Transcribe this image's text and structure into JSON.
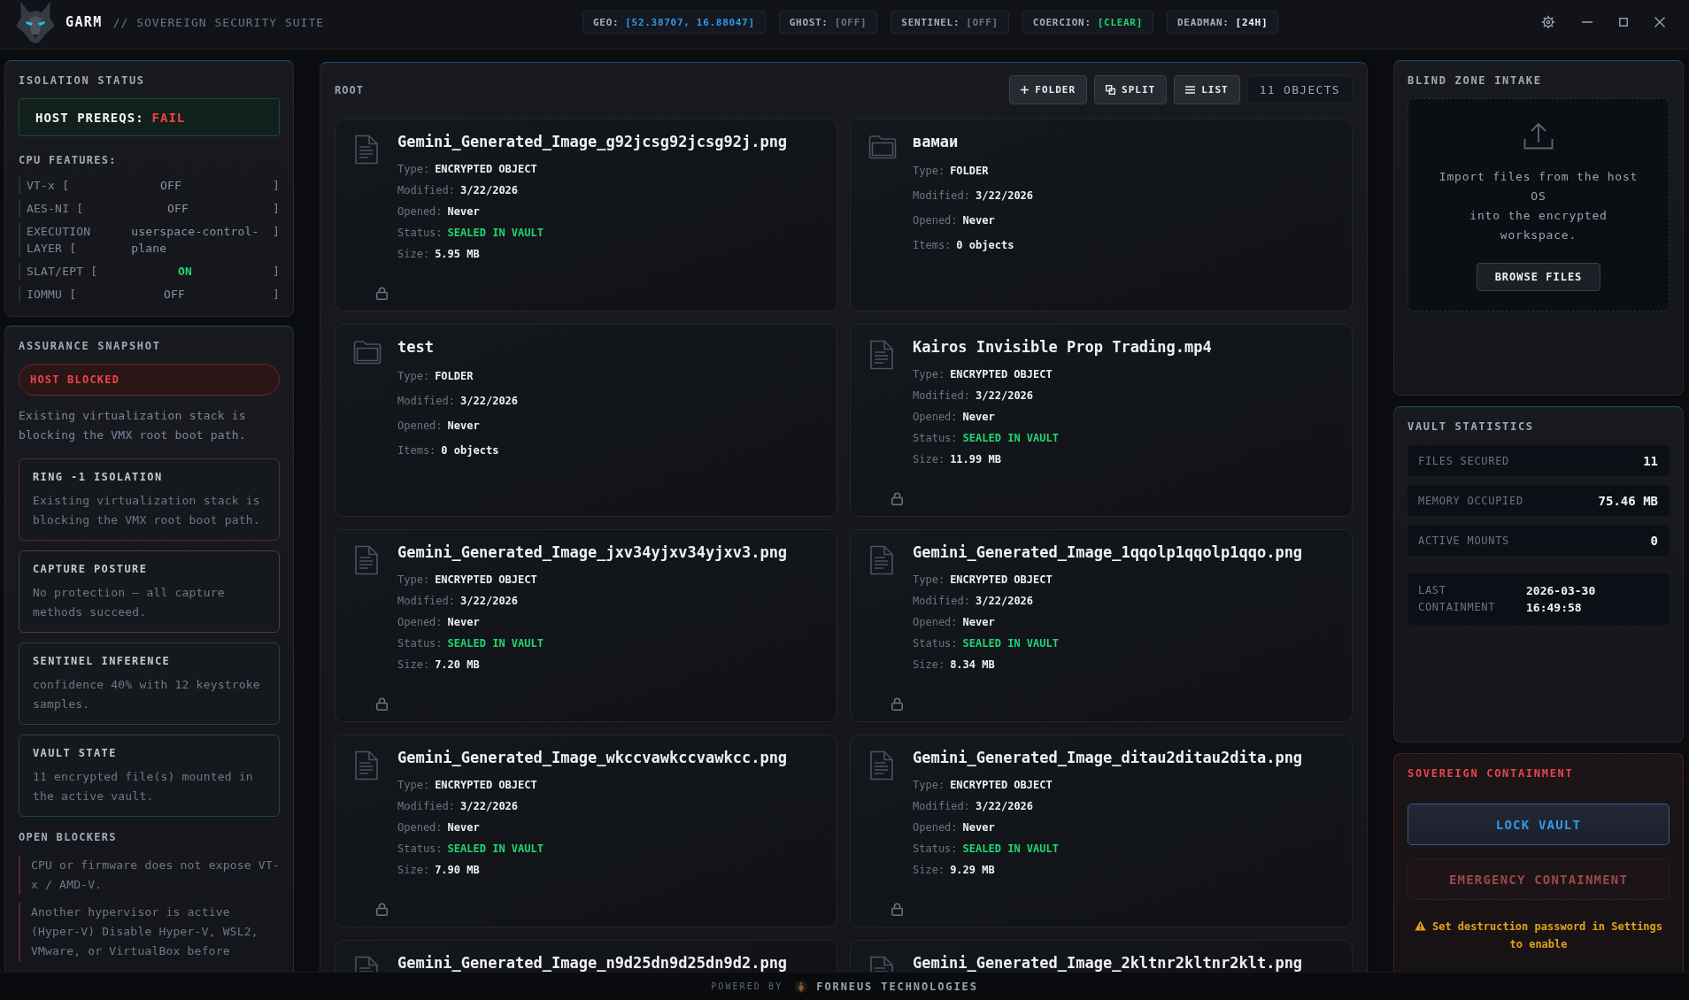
{
  "app": {
    "name": "GARM",
    "subtitle": "// SOVEREIGN SECURITY SUITE"
  },
  "status_chips": [
    {
      "label": "GEO:",
      "value": "[52.38707, 16.88047]",
      "color": "#2f9be8"
    },
    {
      "label": "GHOST:",
      "value": "[OFF]",
      "color": "#6b7385"
    },
    {
      "label": "SENTINEL:",
      "value": "[OFF]",
      "color": "#6b7385"
    },
    {
      "label": "COERCION:",
      "value": "[CLEAR]",
      "color": "#1ed772"
    },
    {
      "label": "DEADMAN:",
      "value": "[24H]",
      "color": "#f2f4f7"
    }
  ],
  "isolation_status": {
    "title": "ISOLATION STATUS",
    "host_prereqs": {
      "label": "HOST PREREQS:",
      "value": "FAIL",
      "passed": false
    },
    "cpu_features_title": "CPU FEATURES:",
    "cpu_features": [
      {
        "label": "VT-x [",
        "value": "OFF",
        "bracket": "]",
        "on": false
      },
      {
        "label": "AES-NI [",
        "value": "OFF",
        "bracket": "]",
        "on": false
      },
      {
        "label": "EXECUTION LAYER [",
        "value": "userspace-control-plane",
        "bracket": "]",
        "on": false
      },
      {
        "label": "SLAT/EPT [",
        "value": "ON",
        "bracket": "]",
        "on": true
      },
      {
        "label": "IOMMU [",
        "value": "OFF",
        "bracket": "]",
        "on": false
      }
    ]
  },
  "assurance": {
    "title": "ASSURANCE SNAPSHOT",
    "status": {
      "label": "HOST BLOCKED",
      "blocked": true
    },
    "summary": "Existing virtualization stack is blocking the VMX root boot path.",
    "cards": [
      {
        "title": "RING -1 ISOLATION",
        "text": "Existing virtualization stack is blocking the VMX root boot path.",
        "color": "#5a2b30"
      },
      {
        "title": "CAPTURE POSTURE",
        "text": "No protection – all capture methods succeed.",
        "color": "#4d4128"
      },
      {
        "title": "SENTINEL INFERENCE",
        "text": "confidence 40% with 12 keystroke samples.",
        "color": "#1f4a3a"
      },
      {
        "title": "VAULT STATE",
        "text": "11 encrypted file(s) mounted in the active vault.",
        "color": "#1f4a3a"
      }
    ],
    "blockers_title": "OPEN BLOCKERS",
    "blockers": [
      "CPU or firmware does not expose VT-x / AMD-V.",
      "Another hypervisor is active (Hyper-V) Disable Hyper-V, WSL2, VMware, or VirtualBox before"
    ]
  },
  "explorer": {
    "path": "ROOT",
    "actions": [
      {
        "kind": "add",
        "label": "FOLDER"
      },
      {
        "kind": "split",
        "label": "SPLIT"
      },
      {
        "kind": "list",
        "label": "LIST"
      }
    ],
    "count": "11 OBJECTS",
    "items": [
      {
        "kind": "file",
        "name": "Gemini_Generated_Image_g92jcsg92jcsg92j.png",
        "fields": [
          {
            "label": "Type:",
            "value": "ENCRYPTED OBJECT"
          },
          {
            "label": "Modified:",
            "value": "3/22/2026"
          },
          {
            "label": "Opened:",
            "value": "Never"
          },
          {
            "label": "Status:",
            "value": "SEALED IN VAULT",
            "color": "#1ed772"
          },
          {
            "label": "Size:",
            "value": "5.95 MB"
          }
        ],
        "locked": true
      },
      {
        "kind": "folder",
        "name": "вамаи",
        "fields": [
          {
            "label": "Type:",
            "value": "FOLDER"
          },
          {
            "label": "Modified:",
            "value": "3/22/2026"
          },
          {
            "label": "Opened:",
            "value": "Never"
          },
          {
            "label": "Items:",
            "value": "0 objects"
          }
        ],
        "locked": false
      },
      {
        "kind": "folder",
        "name": "test",
        "fields": [
          {
            "label": "Type:",
            "value": "FOLDER"
          },
          {
            "label": "Modified:",
            "value": "3/22/2026"
          },
          {
            "label": "Opened:",
            "value": "Never"
          },
          {
            "label": "Items:",
            "value": "0 objects"
          }
        ],
        "locked": false
      },
      {
        "kind": "file",
        "name": "Kairos Invisible Prop Trading.mp4",
        "fields": [
          {
            "label": "Type:",
            "value": "ENCRYPTED OBJECT"
          },
          {
            "label": "Modified:",
            "value": "3/22/2026"
          },
          {
            "label": "Opened:",
            "value": "Never"
          },
          {
            "label": "Status:",
            "value": "SEALED IN VAULT",
            "color": "#1ed772"
          },
          {
            "label": "Size:",
            "value": "11.99 MB"
          }
        ],
        "locked": true
      },
      {
        "kind": "file",
        "name": "Gemini_Generated_Image_jxv34yjxv34yjxv3.png",
        "fields": [
          {
            "label": "Type:",
            "value": "ENCRYPTED OBJECT"
          },
          {
            "label": "Modified:",
            "value": "3/22/2026"
          },
          {
            "label": "Opened:",
            "value": "Never"
          },
          {
            "label": "Status:",
            "value": "SEALED IN VAULT",
            "color": "#1ed772"
          },
          {
            "label": "Size:",
            "value": "7.20 MB"
          }
        ],
        "locked": true
      },
      {
        "kind": "file",
        "name": "Gemini_Generated_Image_1qqolp1qqolp1qqo.png",
        "fields": [
          {
            "label": "Type:",
            "value": "ENCRYPTED OBJECT"
          },
          {
            "label": "Modified:",
            "value": "3/22/2026"
          },
          {
            "label": "Opened:",
            "value": "Never"
          },
          {
            "label": "Status:",
            "value": "SEALED IN VAULT",
            "color": "#1ed772"
          },
          {
            "label": "Size:",
            "value": "8.34 MB"
          }
        ],
        "locked": true
      },
      {
        "kind": "file",
        "name": "Gemini_Generated_Image_wkccvawkccvawkcc.png",
        "fields": [
          {
            "label": "Type:",
            "value": "ENCRYPTED OBJECT"
          },
          {
            "label": "Modified:",
            "value": "3/22/2026"
          },
          {
            "label": "Opened:",
            "value": "Never"
          },
          {
            "label": "Status:",
            "value": "SEALED IN VAULT",
            "color": "#1ed772"
          },
          {
            "label": "Size:",
            "value": "7.90 MB"
          }
        ],
        "locked": true
      },
      {
        "kind": "file",
        "name": "Gemini_Generated_Image_ditau2ditau2dita.png",
        "fields": [
          {
            "label": "Type:",
            "value": "ENCRYPTED OBJECT"
          },
          {
            "label": "Modified:",
            "value": "3/22/2026"
          },
          {
            "label": "Opened:",
            "value": "Never"
          },
          {
            "label": "Status:",
            "value": "SEALED IN VAULT",
            "color": "#1ed772"
          },
          {
            "label": "Size:",
            "value": "9.29 MB"
          }
        ],
        "locked": true
      },
      {
        "kind": "file",
        "name": "Gemini_Generated_Image_n9d25dn9d25dn9d2.png"
      },
      {
        "kind": "file",
        "name": "Gemini_Generated_Image_2kltnr2kltnr2klt.png"
      }
    ]
  },
  "intake": {
    "title": "BLIND ZONE INTAKE",
    "text": "Import files from the host OS\ninto the encrypted workspace.",
    "button": "BROWSE FILES"
  },
  "vault_statistics": {
    "title": "VAULT STATISTICS",
    "rows": [
      {
        "kind": "stat",
        "label": "FILES SECURED",
        "value": "11"
      },
      {
        "kind": "stat",
        "label": "MEMORY OCCUPIED",
        "value": "75.46 MB"
      },
      {
        "kind": "stat",
        "label": "ACTIVE MOUNTS",
        "value": "0"
      },
      {
        "kind": "timestamp",
        "label": "LAST CONTAINMENT",
        "value": "2026-03-30 16:49:58"
      }
    ]
  },
  "containment": {
    "title": "SOVEREIGN CONTAINMENT",
    "buttons": [
      {
        "kind": "lock",
        "label": "LOCK VAULT",
        "disabled": false
      },
      {
        "kind": "emergency",
        "label": "EMERGENCY CONTAINMENT",
        "disabled": true
      }
    ],
    "warning": "Set destruction password in Settings to enable"
  },
  "footer": {
    "powered_by": "POWERED BY",
    "company": "FORNEUS TECHNOLOGIES"
  }
}
